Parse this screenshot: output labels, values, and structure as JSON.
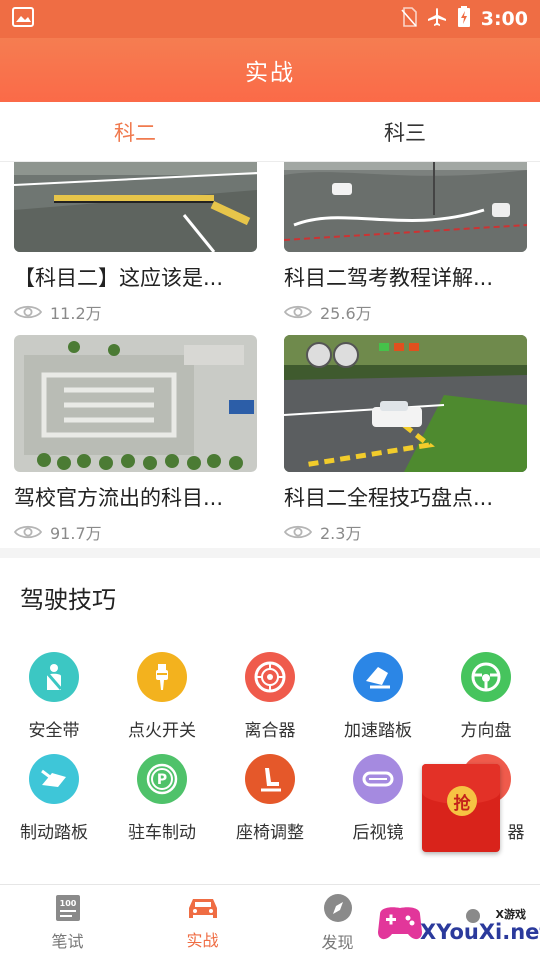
{
  "status_bar": {
    "time": "3:00"
  },
  "header": {
    "title": "实战"
  },
  "tabs": [
    {
      "label": "科二",
      "active": true
    },
    {
      "label": "科三",
      "active": false
    }
  ],
  "videos": [
    {
      "title": "【科目二】这应该是...",
      "views": "11.2万"
    },
    {
      "title": "科目二驾考教程详解...",
      "views": "25.6万"
    },
    {
      "title": "驾校官方流出的科目...",
      "views": "91.7万"
    },
    {
      "title": "科目二全程技巧盘点...",
      "views": "2.3万"
    }
  ],
  "skills_section": {
    "title": "驾驶技巧",
    "items": [
      {
        "label": "安全带",
        "icon": "seatbelt-icon",
        "color": "#3cc7c3"
      },
      {
        "label": "点火开关",
        "icon": "ignition-icon",
        "color": "#f3b21e"
      },
      {
        "label": "离合器",
        "icon": "clutch-icon",
        "color": "#ef5b4c"
      },
      {
        "label": "加速踏板",
        "icon": "accelerator-icon",
        "color": "#2b86e6"
      },
      {
        "label": "方向盘",
        "icon": "steering-wheel-icon",
        "color": "#46c45d"
      },
      {
        "label": "制动踏板",
        "icon": "brake-pedal-icon",
        "color": "#3ec6d8"
      },
      {
        "label": "驻车制动",
        "icon": "parking-brake-icon",
        "color": "#4fc26a"
      },
      {
        "label": "座椅调整",
        "icon": "seat-adjust-icon",
        "color": "#e5582a"
      },
      {
        "label": "后视镜",
        "icon": "mirror-icon",
        "color": "#a58ae0"
      },
      {
        "label": "器",
        "icon": "misc-icon",
        "color": "#ef5b4c"
      }
    ]
  },
  "hongbao": {
    "char": "抢"
  },
  "bottom_nav": [
    {
      "label": "笔试",
      "icon": "exam-icon",
      "active": false
    },
    {
      "label": "实战",
      "icon": "car-icon",
      "active": true
    },
    {
      "label": "发现",
      "icon": "compass-icon",
      "active": false
    },
    {
      "label": "",
      "icon": "profile-icon",
      "active": false
    }
  ],
  "watermark": {
    "small": "X游戏",
    "big": "XYouXi.net"
  }
}
